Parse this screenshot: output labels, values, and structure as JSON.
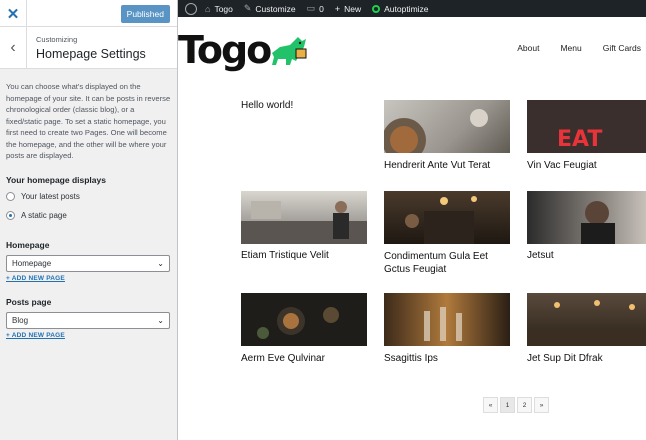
{
  "customizer": {
    "publish_label": "Published",
    "breadcrumb": "Customizing",
    "section_title": "Homepage Settings",
    "description": "You can choose what's displayed on the homepage of your site. It can be posts in reverse chronological order (classic blog), or a fixed/static page. To set a static homepage, you first need to create two Pages. One will become the homepage, and the other will be where your posts are displayed.",
    "displays_label": "Your homepage displays",
    "options": [
      "Your latest posts",
      "A static page"
    ],
    "selected_option": "A static page",
    "homepage_label": "Homepage",
    "homepage_value": "Homepage",
    "posts_page_label": "Posts page",
    "posts_page_value": "Blog",
    "add_new_page": "+ ADD NEW PAGE"
  },
  "adminbar": {
    "site": "Togo",
    "customize": "Customize",
    "comments": "0",
    "new": "New",
    "autoptimize": "Autoptimize",
    "colors": {
      "background": "#1d2327",
      "autoptimize_status": "#1ed14b"
    }
  },
  "site": {
    "logo_text": "Togo",
    "nav": [
      "About",
      "Menu",
      "Gift Cards"
    ],
    "hello_post": "Hello world!",
    "posts": [
      {
        "title": "Hendrerit Ante Vut Terat"
      },
      {
        "title": "Vin Vac Feugiat"
      },
      {
        "title": "Etiam Tristique Velit"
      },
      {
        "title": "Condimentum Gula Eet Gctus Feugiat"
      },
      {
        "title": "Jetsut"
      },
      {
        "title": "Aerm Eve Qulvinar"
      },
      {
        "title": "Ssagittis Ips"
      },
      {
        "title": "Jet Sup Dit Dfrak"
      }
    ],
    "pagination": [
      "«",
      "1",
      "2",
      "»"
    ],
    "current_page": "1"
  },
  "icons": [
    "close-icon",
    "chevron-left-icon",
    "chevron-down-icon",
    "wordpress-icon",
    "home-icon",
    "brush-icon",
    "comment-icon",
    "plus-icon",
    "dog-mascot-icon"
  ]
}
